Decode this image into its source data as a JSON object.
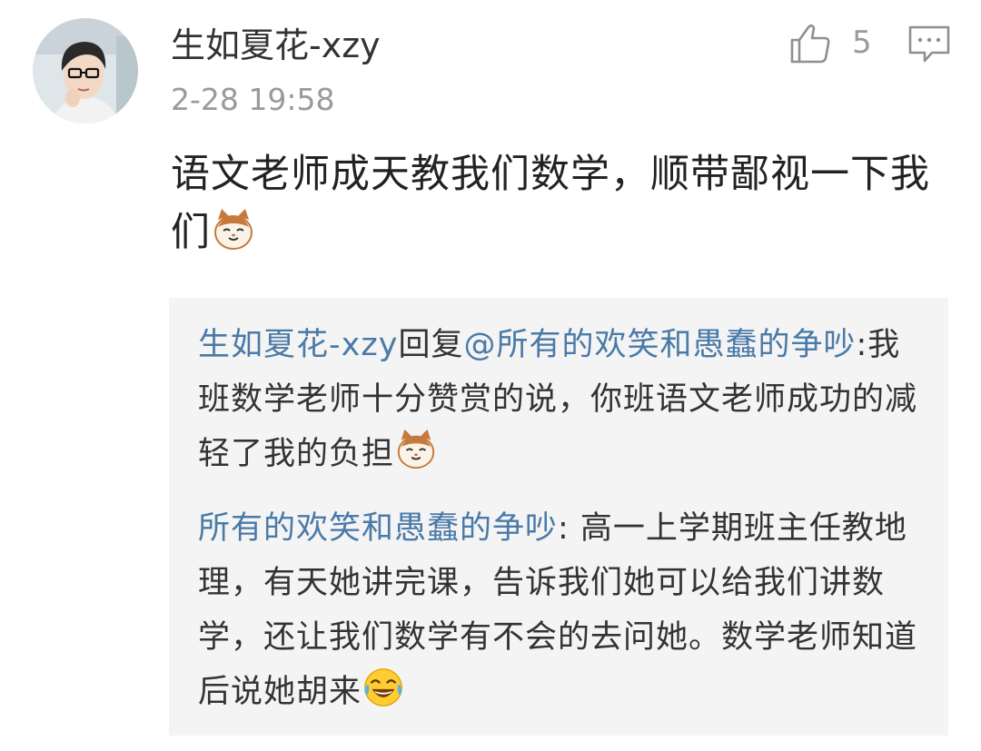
{
  "user": {
    "name": "生如夏花-xzy",
    "time": "2-28 19:58",
    "avatar_icon": "user-avatar"
  },
  "actions": {
    "like_icon": "thumbs-up-icon",
    "like_count": "5",
    "comment_icon": "comment-icon"
  },
  "comment": {
    "text": "语文老师成天教我们数学，顺带鄙视一下我们",
    "emoji": "cat-face-emoji"
  },
  "replies": [
    {
      "author": "生如夏花-xzy",
      "verb": "回复",
      "target": "@所有的欢笑和愚蠢的争吵",
      "text": ":我班数学老师十分赞赏的说，你班语文老师成功的减轻了我的负担",
      "emoji": "cat-face-emoji"
    },
    {
      "author": "所有的欢笑和愚蠢的争吵",
      "text": ": 高一上学期班主任教地理，有天她讲完课，告诉我们她可以给我们讲数学，还让我们数学有不会的去问她。数学老师知道后说她胡来",
      "emoji": "tears-of-joy-emoji"
    }
  ],
  "colors": {
    "link": "#4a7aa8",
    "meta": "#9a9a9a",
    "quote_bg": "#f4f4f4"
  }
}
